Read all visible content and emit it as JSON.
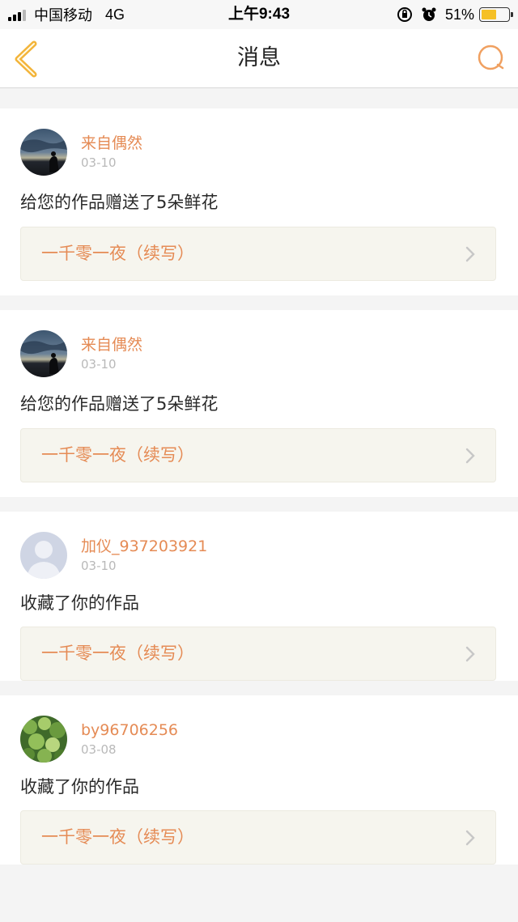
{
  "status_bar": {
    "carrier": "中国移动",
    "network": "4G",
    "time": "上午9:43",
    "battery": "51%",
    "battery_level": 0.51
  },
  "nav": {
    "title": "消息",
    "back_icon": "chevron-left-icon",
    "search_icon": "search-icon",
    "accent_color": "#f3b43a"
  },
  "messages": [
    {
      "user": "来自偶然",
      "date": "03-10",
      "text": "给您的作品赠送了5朵鲜花",
      "work": "一千零一夜（续写）",
      "avatar": "sunset-silhouette"
    },
    {
      "user": "来自偶然",
      "date": "03-10",
      "text": "给您的作品赠送了5朵鲜花",
      "work": "一千零一夜（续写）",
      "avatar": "sunset-silhouette"
    },
    {
      "user": "加仪_937203921",
      "date": "03-10",
      "text": "收藏了你的作品",
      "work": "一千零一夜（续写）",
      "avatar": "default-user"
    },
    {
      "user": "by96706256",
      "date": "03-08",
      "text": "收藏了你的作品",
      "work": "一千零一夜（续写）",
      "avatar": "green-leaves"
    }
  ],
  "colors": {
    "username": "#e58b55",
    "date": "#b9b9b9",
    "work_bg": "#f6f5ee"
  }
}
